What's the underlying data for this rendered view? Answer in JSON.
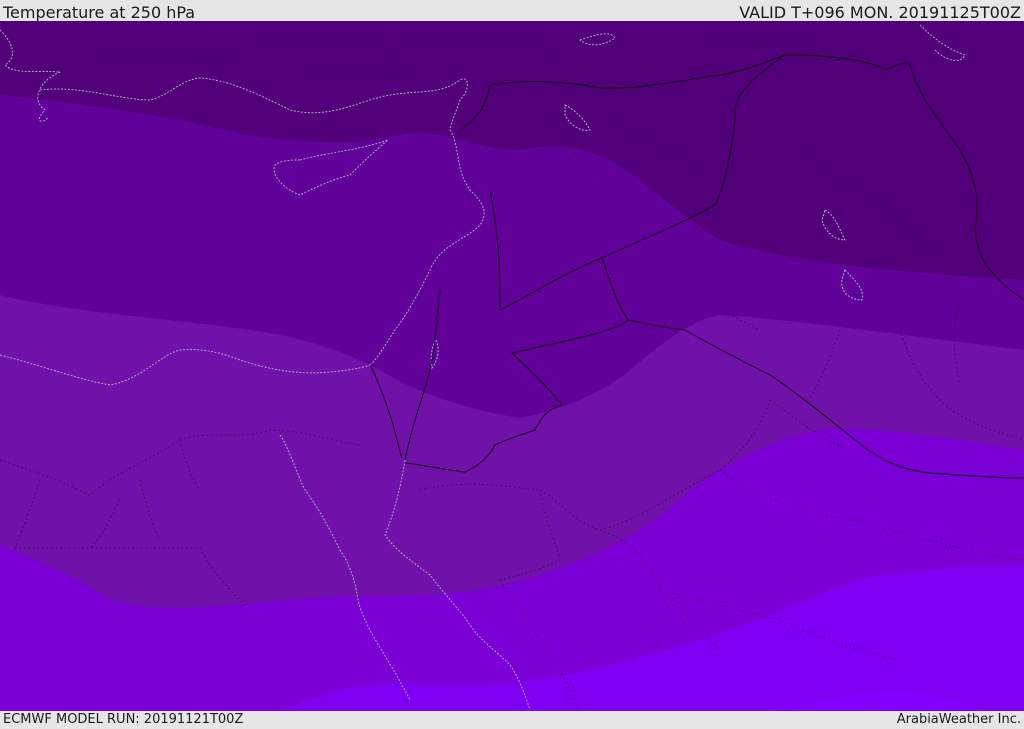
{
  "header": {
    "title": "Temperature at 250 hPa",
    "valid": "VALID T+096 MON. 20191125T00Z"
  },
  "footer": {
    "model_run": "ECMWF MODEL RUN: 20191121T00Z",
    "provider": "ArabiaWeather Inc."
  },
  "map": {
    "bands": [
      {
        "name": "band-1",
        "color": "#52007a"
      },
      {
        "name": "band-2",
        "color": "#62009a"
      },
      {
        "name": "band-3",
        "color": "#7011aa"
      },
      {
        "name": "band-4",
        "color": "#7a00d6"
      },
      {
        "name": "band-5",
        "color": "#7d00f2"
      },
      {
        "name": "band-6",
        "color": "#7f00ff"
      },
      {
        "name": "band-7",
        "color": "#6e22ee"
      }
    ]
  }
}
